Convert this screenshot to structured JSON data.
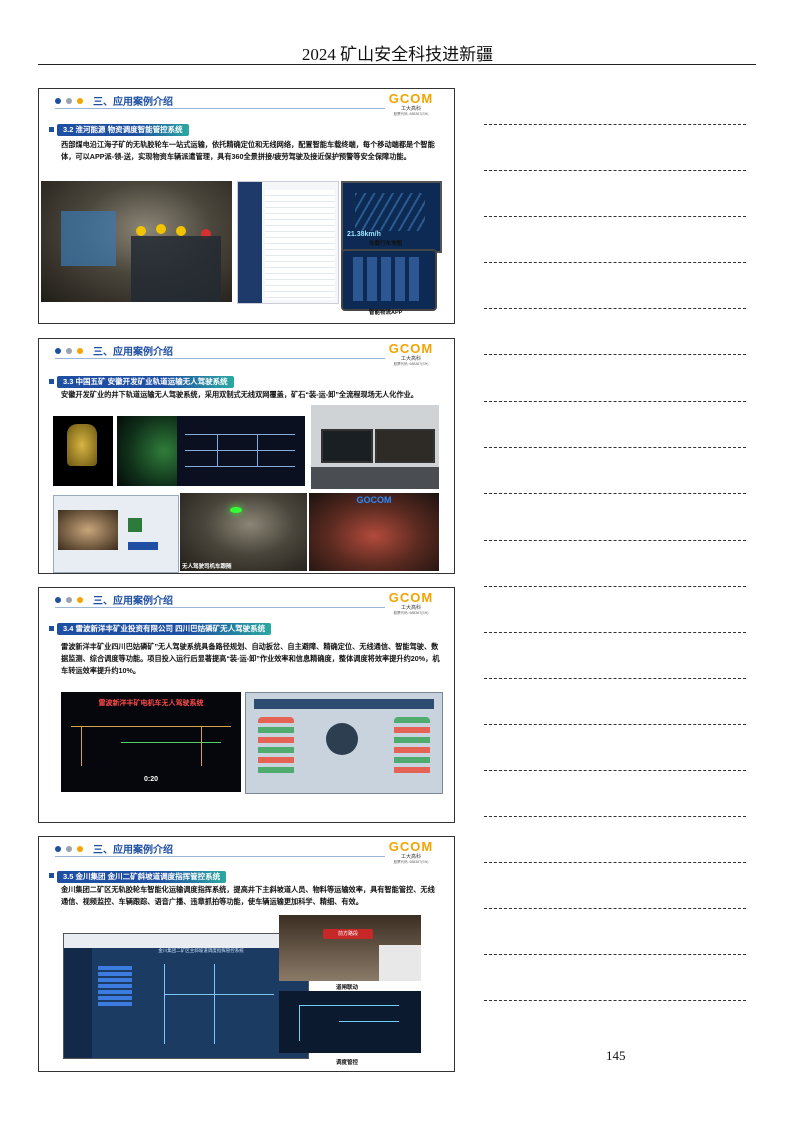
{
  "header": {
    "title": "2024 矿山安全科技进新疆"
  },
  "slides": [
    {
      "section_title": "三、应用案例介绍",
      "logo": {
        "brand": "GCOM",
        "sub": "工大高科",
        "tiny": "股票代码: 688367(SH)"
      },
      "case_tag": "3.2 淮河能源 物资调度智能管控系统",
      "description": "西部煤电沿江海子矿的无轨胶轮车一站式运输，依托精确定位和无线网络，配置智能车载终端，每个移动端都是个智能体，可以APP派-领-送，实现物资车辆派遣管理，具有360全景拼接/疲劳驾驶及接近保护预警等安全保障功能。",
      "captions": [
        "车载行车地图",
        "智能物流APP"
      ],
      "speed": "21.38km/h"
    },
    {
      "section_title": "三、应用案例介绍",
      "logo": {
        "brand": "GCOM",
        "sub": "工大高科",
        "tiny": "股票代码: 688367(SH)"
      },
      "case_tag": "3.3 中国五矿 安徽开发矿业轨道运输无人驾驶系统",
      "description": "安徽开发矿业的井下轨道运输无人驾驶系统，采用双制式无线双网覆盖，矿石“装-运-卸”全流程现场无人化作业。",
      "watermark": "GOCOM",
      "captions": [
        "无人驾驶司机车跟随"
      ]
    },
    {
      "section_title": "三、应用案例介绍",
      "logo": {
        "brand": "GCOM",
        "sub": "工大高科",
        "tiny": "股票代码: 688367(SH)"
      },
      "case_tag": "3.4 雷波新洋丰矿业投资有限公司 四川巴姑磷矿无人驾驶系统",
      "description": "雷波新洋丰矿业四川巴姑磷矿”无人驾驶系统具备路径规划、自动扳岔、自主避障、精确定位、无线通信、智能驾驶、数据监测、综合调度等功能。项目投入运行后显著提高“装-运-卸”作业效率和信息精确度，整体调度将效率提升约20%，机车转运效率提升约10%。",
      "screen_title": "雷波新洋丰矿电机车无人驾驶系统",
      "clock": "0:20"
    },
    {
      "section_title": "三、应用案例介绍",
      "logo": {
        "brand": "GCOM",
        "sub": "工大高科",
        "tiny": "股票代码: 688367(SH)"
      },
      "case_tag": "3.5 金川集团 金川二矿斜坡道调度指挥管控系统",
      "description": "金川集团二矿区无轨胶轮车智能化运输调度指挥系统，提高井下主斜坡道人员、物料等运输效率，具有智能管控、无线通信、视频监控、车辆跟踪、语音广播、违章抓拍等功能，使车辆运输更加科学、精细、有效。",
      "screen_title": "金川集团二矿区主斜坡道调度指挥管控系统",
      "sign": "前方路段",
      "captions": [
        "道闸联动",
        "调度管控"
      ]
    }
  ],
  "page_number": "145",
  "colors": {
    "accent": "#1f4fa3",
    "dot1": "#1f4fa3",
    "dot2": "#9aa3ad",
    "dot3": "#f2a400"
  }
}
